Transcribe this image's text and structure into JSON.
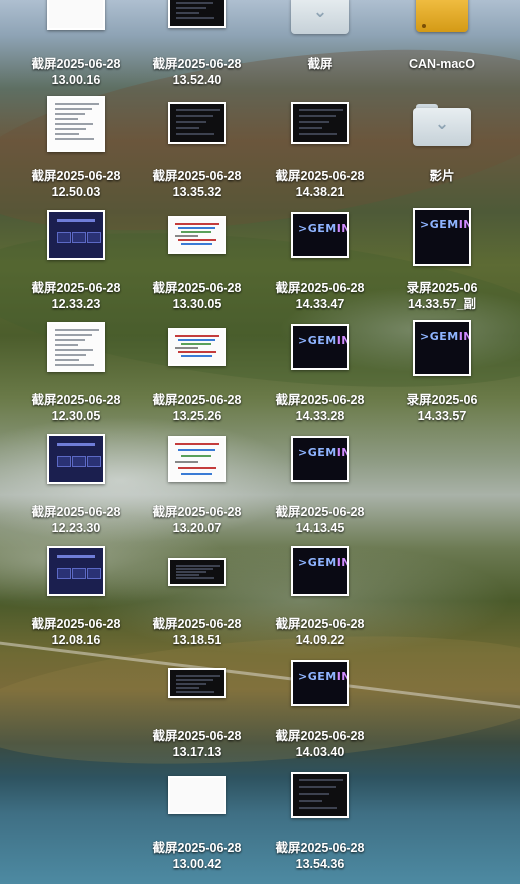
{
  "desktop": {
    "icons": [
      {
        "name": "screenshot-13-00-16",
        "kind": "white",
        "line1": "截屏2025-06-28",
        "line2": "13.00.16"
      },
      {
        "name": "screenshot-13-52-40",
        "kind": "dark",
        "line1": "截屏2025-06-28",
        "line2": "13.52.40"
      },
      {
        "name": "folder-jieping",
        "kind": "folder",
        "line1": "截屏",
        "line2": "",
        "icon": "chevron-down-icon"
      },
      {
        "name": "drive-can-macos",
        "kind": "drive",
        "line1": "CAN-macO",
        "line2": ""
      },
      {
        "name": "screenshot-12-50-03",
        "kind": "doc",
        "line1": "截屏2025-06-28",
        "line2": "12.50.03"
      },
      {
        "name": "screenshot-13-35-32",
        "kind": "dark",
        "line1": "截屏2025-06-28",
        "line2": "13.35.32"
      },
      {
        "name": "screenshot-14-38-21",
        "kind": "dark",
        "line1": "截屏2025-06-28",
        "line2": "14.38.21"
      },
      {
        "name": "folder-yingpian",
        "kind": "folder",
        "line1": "影片",
        "line2": "",
        "icon": "chevron-down-icon"
      },
      {
        "name": "screenshot-12-33-23",
        "kind": "slide",
        "line1": "截屏2025-06-28",
        "line2": "12.33.23"
      },
      {
        "name": "screenshot-13-30-05",
        "kind": "code",
        "line1": "截屏2025-06-28",
        "line2": "13.30.05"
      },
      {
        "name": "screenshot-14-33-47",
        "kind": "gemini",
        "line1": "截屏2025-06-28",
        "line2": "14.33.47"
      },
      {
        "name": "recording-14-33-57-copy",
        "kind": "gemini",
        "line1": "录屏2025-06",
        "line2": "14.33.57_副"
      },
      {
        "name": "screenshot-12-30-05",
        "kind": "doc",
        "line1": "截屏2025-06-28",
        "line2": "12.30.05"
      },
      {
        "name": "screenshot-13-25-26",
        "kind": "code",
        "line1": "截屏2025-06-28",
        "line2": "13.25.26"
      },
      {
        "name": "screenshot-14-33-28",
        "kind": "gemini",
        "line1": "截屏2025-06-28",
        "line2": "14.33.28"
      },
      {
        "name": "recording-14-33-57",
        "kind": "gemini",
        "line1": "录屏2025-06",
        "line2": "14.33.57"
      },
      {
        "name": "screenshot-12-23-30",
        "kind": "slide",
        "line1": "截屏2025-06-28",
        "line2": "12.23.30"
      },
      {
        "name": "screenshot-13-20-07",
        "kind": "code",
        "line1": "截屏2025-06-28",
        "line2": "13.20.07"
      },
      {
        "name": "screenshot-14-13-45",
        "kind": "gemini",
        "line1": "截屏2025-06-28",
        "line2": "14.13.45"
      },
      {
        "name": "screenshot-12-08-16",
        "kind": "slide",
        "line1": "截屏2025-06-28",
        "line2": "12.08.16"
      },
      {
        "name": "screenshot-13-18-51",
        "kind": "dark",
        "line1": "截屏2025-06-28",
        "line2": "13.18.51"
      },
      {
        "name": "screenshot-14-09-22",
        "kind": "gemini",
        "line1": "截屏2025-06-28",
        "line2": "14.09.22"
      },
      {
        "name": "screenshot-13-17-13",
        "kind": "dark",
        "line1": "截屏2025-06-28",
        "line2": "13.17.13"
      },
      {
        "name": "screenshot-14-03-40",
        "kind": "gemini",
        "line1": "截屏2025-06-28",
        "line2": "14.03.40"
      },
      {
        "name": "screenshot-13-00-42",
        "kind": "white",
        "line1": "截屏2025-06-28",
        "line2": "13.00.42"
      },
      {
        "name": "screenshot-13-54-36",
        "kind": "dark",
        "line1": "截屏2025-06-28",
        "line2": "13.54.36"
      }
    ],
    "gemini_logo": "GEMINI",
    "colors": {
      "label": "#ffffff",
      "drive": "#e6ae2a",
      "gemini_blue": "#8fb4ff",
      "gemini_pink": "#d08cff"
    }
  }
}
